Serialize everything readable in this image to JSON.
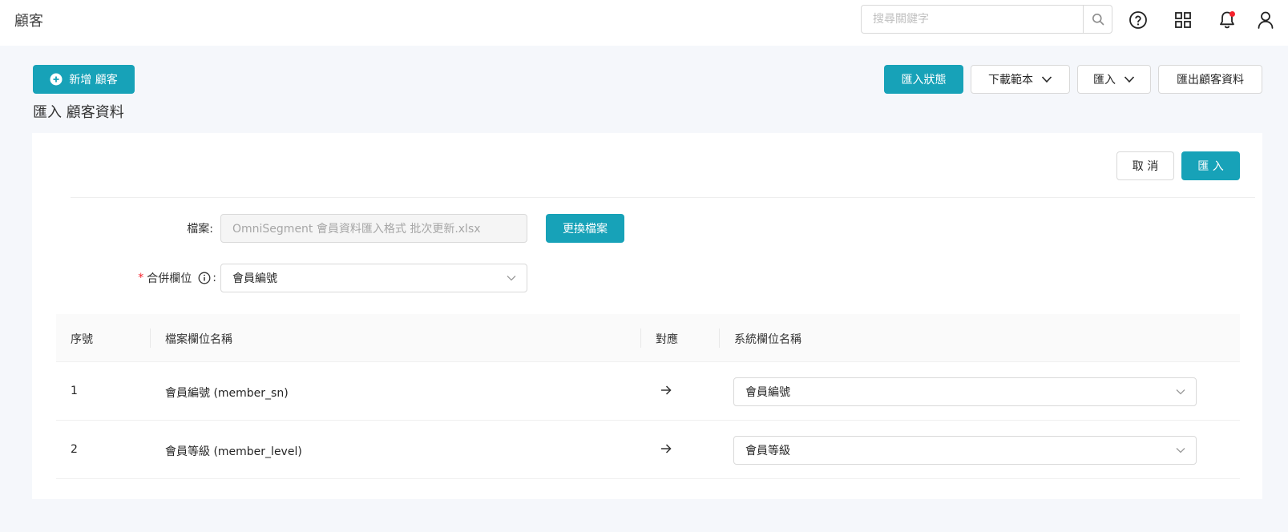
{
  "header": {
    "title": "顧客",
    "search_placeholder": "搜尋關鍵字"
  },
  "toolbar": {
    "add_customer_label": "新增 顧客",
    "import_status_label": "匯入狀態",
    "download_template_label": "下載範本",
    "import_label": "匯入",
    "export_label": "匯出顧客資料"
  },
  "page": {
    "section_title": "匯入 顧客資料"
  },
  "form": {
    "cancel_label": "取 消",
    "submit_label": "匯 入",
    "file_label": "檔案:",
    "file_value": "OmniSegment 會員資料匯入格式 批次更新.xlsx",
    "replace_file_label": "更換檔案",
    "merge_field_label": "合併欄位",
    "merge_field_colon": ":",
    "merge_field_value": "會員編號"
  },
  "table": {
    "columns": [
      "序號",
      "檔案欄位名稱",
      "對應",
      "系統欄位名稱"
    ],
    "rows": [
      {
        "index": "1",
        "file_field": "會員編號 (member_sn)",
        "system_field": "會員編號"
      },
      {
        "index": "2",
        "file_field": "會員等級 (member_level)",
        "system_field": "會員等級"
      }
    ]
  },
  "colors": {
    "primary": "#17a2b8",
    "notification_dot": "#f5222d"
  }
}
